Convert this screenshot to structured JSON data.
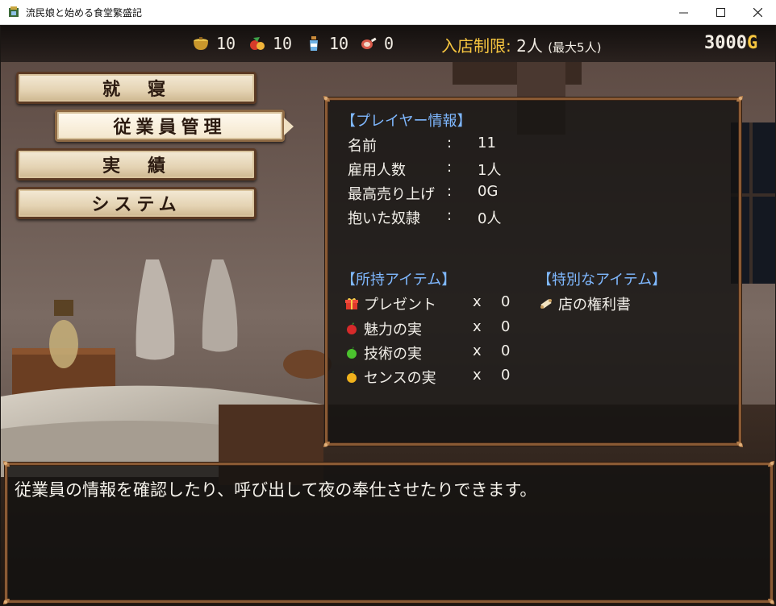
{
  "window": {
    "title": "流民娘と始める食堂繁盛記",
    "minimize_glyph": "—",
    "maximize_glyph": "☐",
    "close_glyph": "✕"
  },
  "hud": {
    "resources": [
      {
        "icon": "pot-icon",
        "value": "10"
      },
      {
        "icon": "vegetables-icon",
        "value": "10"
      },
      {
        "icon": "seasoning-icon",
        "value": "10"
      },
      {
        "icon": "meat-icon",
        "value": "0"
      }
    ],
    "limit_label": "入店制限:",
    "limit_value": "2人",
    "limit_max": "(最大5人)",
    "gold_value": "3000",
    "gold_unit": "G"
  },
  "menu": {
    "items": [
      {
        "label": "就　寝"
      },
      {
        "label": "従業員管理"
      },
      {
        "label": "実　績"
      },
      {
        "label": "システム"
      }
    ]
  },
  "player_panel": {
    "heading": "【プレイヤー情報】",
    "rows": [
      {
        "label": "名前",
        "sep": ":",
        "value": "11"
      },
      {
        "label": "雇用人数",
        "sep": ":",
        "value": "1人"
      },
      {
        "label": "最高売り上げ",
        "sep": ":",
        "value": "0G"
      },
      {
        "label": "抱いた奴隷",
        "sep": ":",
        "value": "0人"
      }
    ],
    "items_heading": "【所持アイテム】",
    "items": [
      {
        "icon": "present-icon",
        "name": "プレゼント",
        "x": "x",
        "count": "0"
      },
      {
        "icon": "red-fruit-icon",
        "name": "魅力の実",
        "x": "x",
        "count": "0"
      },
      {
        "icon": "green-fruit-icon",
        "name": "技術の実",
        "x": "x",
        "count": "0"
      },
      {
        "icon": "yellow-fruit-icon",
        "name": "センスの実",
        "x": "x",
        "count": "0"
      }
    ],
    "special_heading": "【特別なアイテム】",
    "special_items": [
      {
        "icon": "scroll-icon",
        "name": "店の権利書"
      }
    ]
  },
  "message": {
    "text": "従業員の情報を確認したり、呼び出して夜の奉仕させたりできます。"
  },
  "colors": {
    "hud_accent": "#f7c640",
    "section_heading": "#7fb8ff",
    "panel_border": "#8a5a34"
  }
}
